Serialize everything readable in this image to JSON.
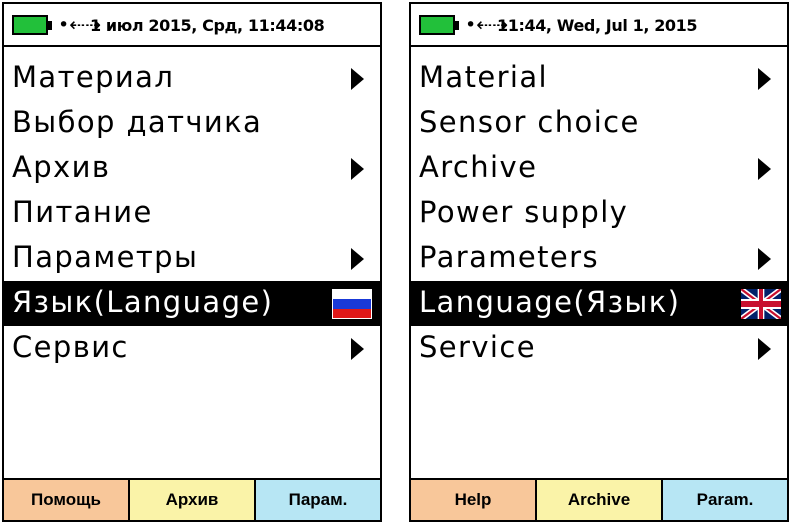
{
  "colors": {
    "battery": "#22c03a",
    "help_key": "#f8c79a",
    "archive_key": "#faf3a8",
    "params_key": "#b7e6f4",
    "selection": "#000000"
  },
  "screens": [
    {
      "status": {
        "usb_symbol": "•⇠⇢",
        "datetime": "1 июл 2015, Срд, 11:44:08"
      },
      "menu": [
        {
          "label": "Материал",
          "submenu": true
        },
        {
          "label": "Выбор датчика",
          "submenu": false
        },
        {
          "label": "Архив",
          "submenu": true
        },
        {
          "label": "Питание",
          "submenu": false
        },
        {
          "label": "Параметры",
          "submenu": true
        },
        {
          "label": "Язык(Language)",
          "selected": true,
          "icon": "russian-flag-icon"
        },
        {
          "label": "Сервис",
          "submenu": true
        }
      ],
      "softkeys": [
        "Помощь",
        "Архив",
        "Парам."
      ]
    },
    {
      "status": {
        "usb_symbol": "•⇠⇢",
        "datetime": "11:44, Wed, Jul 1, 2015"
      },
      "menu": [
        {
          "label": "Material",
          "submenu": true
        },
        {
          "label": "Sensor choice",
          "submenu": false
        },
        {
          "label": "Archive",
          "submenu": true
        },
        {
          "label": "Power supply",
          "submenu": false
        },
        {
          "label": "Parameters",
          "submenu": true
        },
        {
          "label": "Language(Язык)",
          "selected": true,
          "icon": "uk-flag-icon"
        },
        {
          "label": "Service",
          "submenu": true
        }
      ],
      "softkeys": [
        "Help",
        "Archive",
        "Param."
      ]
    }
  ]
}
